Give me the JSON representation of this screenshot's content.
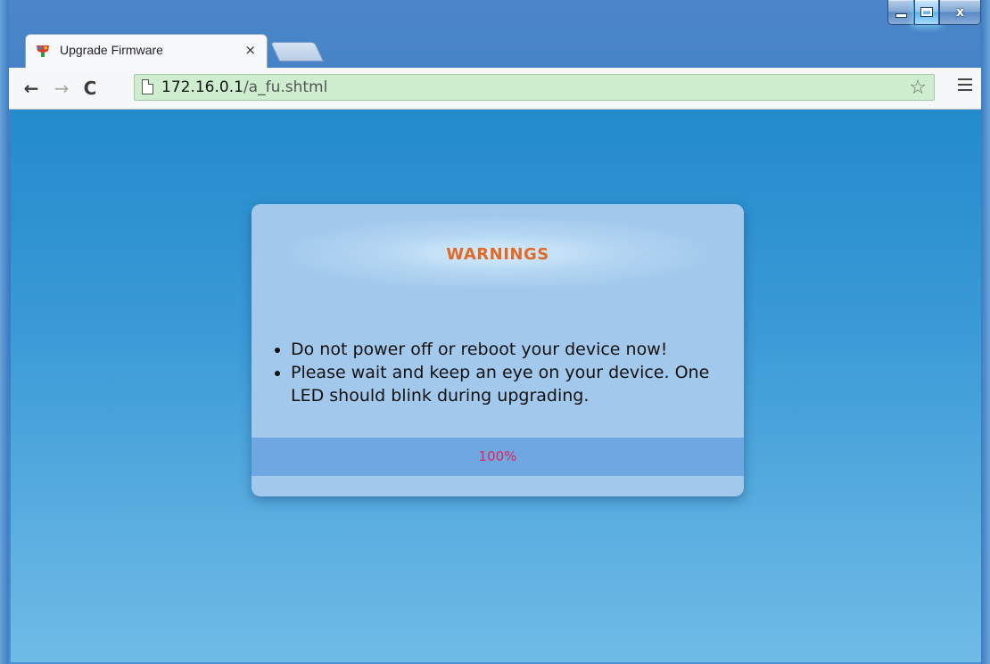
{
  "browser": {
    "tab": {
      "title": "Upgrade Firmware",
      "close_glyph": "×",
      "favicon": "router-favicon-icon"
    },
    "toolbar": {
      "back_glyph": "←",
      "forward_glyph": "→",
      "reload_glyph": "C",
      "url_host": "172.16.0.1",
      "url_path": "/a_fu.shtml",
      "star_glyph": "☆",
      "omnibox_color": "#cfeed0"
    },
    "window_controls": {
      "close_glyph": "x"
    }
  },
  "dialog": {
    "title": "WARNINGS",
    "title_color": "#e06a2a",
    "items": [
      "Do not power off or reboot your device now!",
      "Please wait and keep an eye on your device. One LED should blink during upgrading."
    ],
    "progress": {
      "value": 1.0,
      "label": "100%",
      "label_color": "#e3245a",
      "fill_color": "#6fa7e2"
    }
  },
  "colors": {
    "background_top": "#238bcc",
    "background_bottom": "#6fbbe6",
    "dialog_bg": "#a2c9ec"
  }
}
